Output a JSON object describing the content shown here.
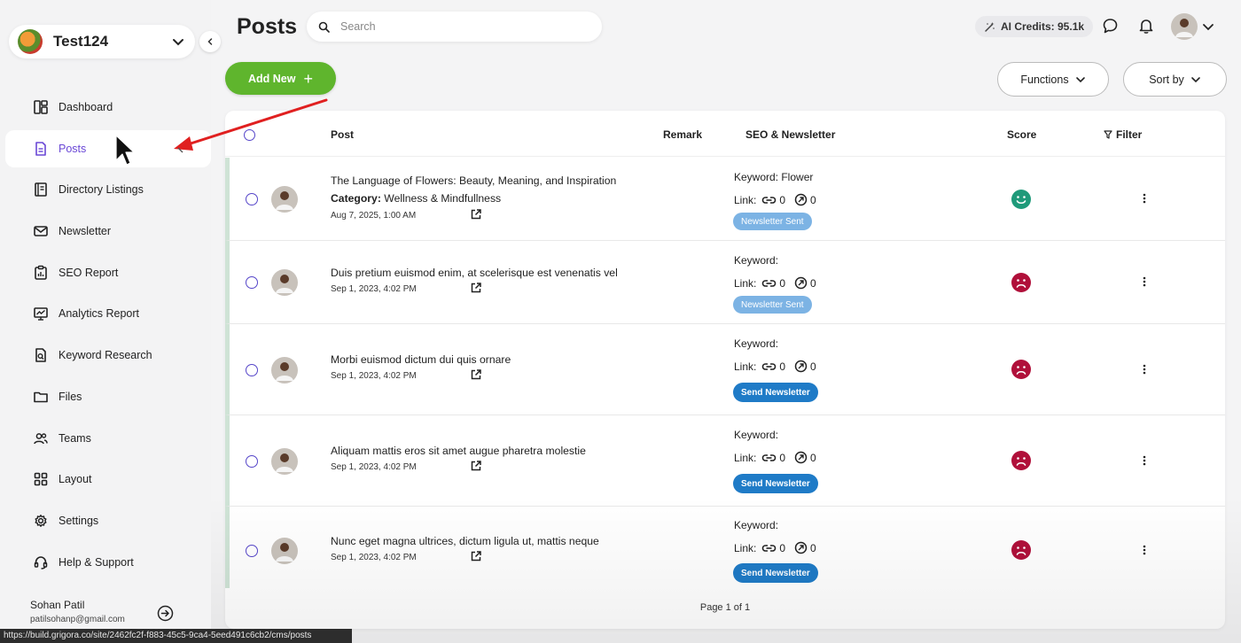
{
  "workspace": {
    "name": "Test124"
  },
  "sidebar": {
    "items": [
      {
        "label": "Dashboard",
        "icon": "dashboard-icon"
      },
      {
        "label": "Posts",
        "icon": "document-icon",
        "active": true
      },
      {
        "label": "Directory Listings",
        "icon": "directory-icon"
      },
      {
        "label": "Newsletter",
        "icon": "mail-icon"
      },
      {
        "label": "SEO Report",
        "icon": "clipboard-icon"
      },
      {
        "label": "Analytics Report",
        "icon": "analytics-icon"
      },
      {
        "label": "Keyword Research",
        "icon": "keyword-search-icon"
      },
      {
        "label": "Files",
        "icon": "folder-icon"
      },
      {
        "label": "Teams",
        "icon": "users-icon"
      },
      {
        "label": "Layout",
        "icon": "layout-grid-icon"
      },
      {
        "label": "Settings",
        "icon": "gear-icon"
      },
      {
        "label": "Help & Support",
        "icon": "headset-icon"
      }
    ],
    "user": {
      "name": "Sohan Patil",
      "email": "patilsohanp@gmail.com"
    }
  },
  "header": {
    "title": "Posts",
    "search_placeholder": "Search",
    "credits": "AI Credits: 95.1k"
  },
  "toolbar": {
    "add_new": "Add New",
    "add_plus": "+",
    "functions": "Functions",
    "sort_by": "Sort by"
  },
  "table": {
    "headers": {
      "post": "Post",
      "remark": "Remark",
      "seo": "SEO & Newsletter",
      "score": "Score",
      "filter": "Filter"
    },
    "link_label": "Link:",
    "category_label": "Category:",
    "rows": [
      {
        "title": "The Language of Flowers: Beauty, Meaning, and Inspiration",
        "category": "Wellness & Mindfullness",
        "date": "Aug 7, 2025, 1:00 AM",
        "keyword": "Keyword: Flower",
        "links": "0",
        "ext_links": "0",
        "newsletter": "Newsletter Sent",
        "newsletter_state": "sent",
        "score": "good"
      },
      {
        "title": "Duis pretium euismod enim, at scelerisque est venenatis vel",
        "category": "",
        "date": "Sep 1, 2023, 4:02 PM",
        "keyword": "Keyword:",
        "links": "0",
        "ext_links": "0",
        "newsletter": "Newsletter Sent",
        "newsletter_state": "sent",
        "score": "bad"
      },
      {
        "title": "Morbi euismod dictum dui quis ornare",
        "category": "",
        "date": "Sep 1, 2023, 4:02 PM",
        "keyword": "Keyword:",
        "links": "0",
        "ext_links": "0",
        "newsletter": "Send Newsletter",
        "newsletter_state": "send",
        "score": "bad"
      },
      {
        "title": "Aliquam mattis eros sit amet augue pharetra molestie",
        "category": "",
        "date": "Sep 1, 2023, 4:02 PM",
        "keyword": "Keyword:",
        "links": "0",
        "ext_links": "0",
        "newsletter": "Send Newsletter",
        "newsletter_state": "send",
        "score": "bad"
      },
      {
        "title": "Nunc eget magna ultrices, dictum ligula ut, mattis neque",
        "category": "",
        "date": "Sep 1, 2023, 4:02 PM",
        "keyword": "Keyword:",
        "links": "0",
        "ext_links": "0",
        "newsletter": "Send Newsletter",
        "newsletter_state": "send",
        "score": "bad"
      }
    ],
    "pager": "Page 1 of 1"
  },
  "statusbar": {
    "url": "https://build.grigora.co/site/2462fc2f-f883-45c5-9ca4-5eed491c6cb2/cms/posts"
  },
  "colors": {
    "accent": "#6a48d6",
    "add_button": "#5fb52d",
    "score_good": "#1f9a7a",
    "score_bad": "#b0103a",
    "badge_sent": "#7cb3e4",
    "badge_send": "#1f7bc7"
  }
}
